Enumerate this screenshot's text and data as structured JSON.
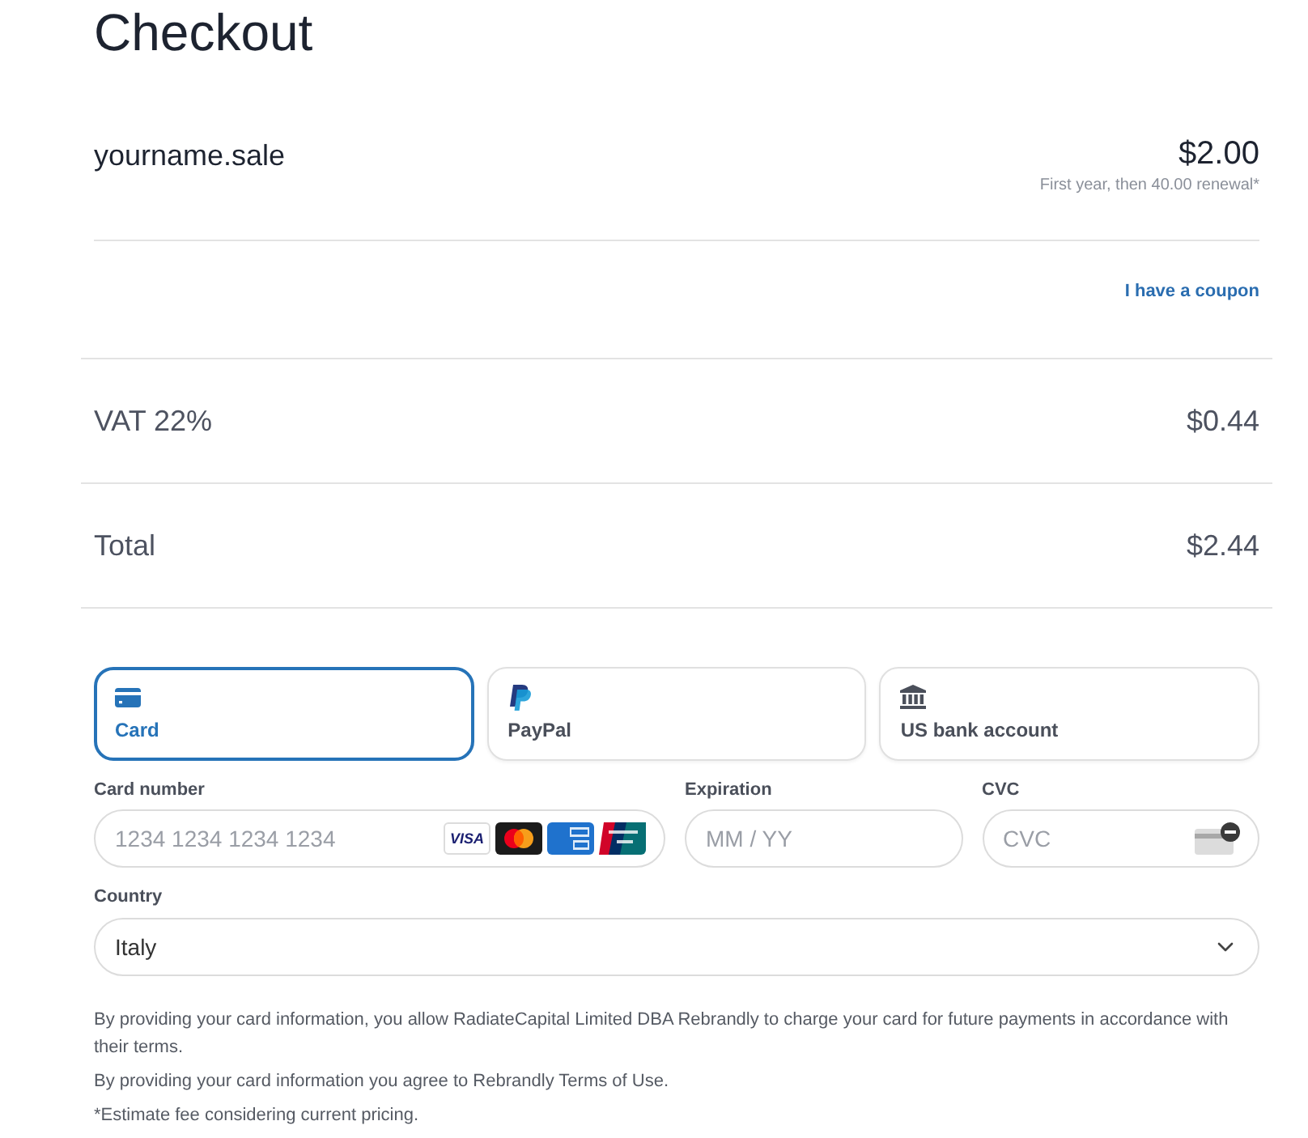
{
  "title": "Checkout",
  "line_item": {
    "name": "yourname.sale",
    "price": "$2.00",
    "note": "First year, then 40.00 renewal*"
  },
  "coupon_link": "I have a coupon",
  "summary_rows": [
    {
      "label": "VAT 22%",
      "amount": "$0.44"
    },
    {
      "label": "Total",
      "amount": "$2.44"
    }
  ],
  "payment_methods": [
    {
      "kind": "card",
      "label": "Card",
      "selected": true
    },
    {
      "kind": "paypal",
      "label": "PayPal",
      "selected": false
    },
    {
      "kind": "bank",
      "label": "US bank account",
      "selected": false
    }
  ],
  "card_form": {
    "card_number": {
      "label": "Card number",
      "placeholder": "1234 1234 1234 1234",
      "brands": [
        {
          "kind": "visa",
          "label": "VISA"
        },
        {
          "kind": "mastercard"
        },
        {
          "kind": "amex"
        },
        {
          "kind": "unionpay"
        }
      ]
    },
    "expiration": {
      "label": "Expiration",
      "placeholder": "MM / YY"
    },
    "cvc": {
      "label": "CVC",
      "placeholder": "CVC"
    },
    "country": {
      "label": "Country",
      "value": "Italy"
    }
  },
  "disclaimers": [
    "By providing your card information, you allow RadiateCapital Limited DBA Rebrandly to charge your card for future payments in accordance with their terms.",
    "By providing your card information you agree to Rebrandly Terms of Use.",
    "*Estimate fee considering current pricing."
  ]
}
